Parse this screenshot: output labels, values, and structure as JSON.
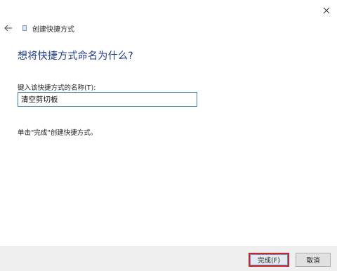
{
  "header": {
    "back_icon": "arrow-left-icon",
    "wizard_icon": "shortcut-wizard-icon",
    "title": "创建快捷方式",
    "close_icon": "close-icon"
  },
  "main": {
    "heading": "想将快捷方式命名为什么?",
    "field_label": "键入该快捷方式的名称(T):",
    "name_value": "清空剪切板",
    "instruction": "单击\"完成\"创建快捷方式。"
  },
  "footer": {
    "finish_label": "完成(F)",
    "cancel_label": "取消"
  },
  "colors": {
    "heading": "#1e3d8f",
    "input_border": "#3c7fb1",
    "finish_highlight": "#c9252c"
  }
}
